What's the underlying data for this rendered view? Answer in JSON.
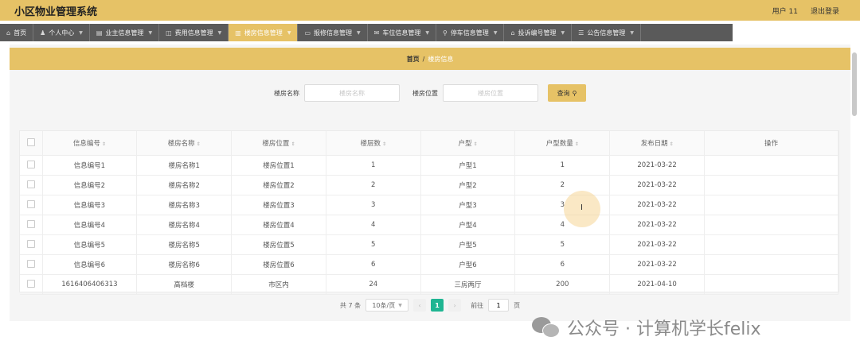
{
  "app": {
    "title": "小区物业管理系统",
    "user": "用户 11",
    "logout": "退出登录"
  },
  "nav": {
    "items": [
      {
        "icon": "⌂",
        "label": "首页",
        "active": false
      },
      {
        "icon": "♟",
        "label": "个人中心",
        "active": false
      },
      {
        "icon": "▤",
        "label": "业主信息管理",
        "active": false
      },
      {
        "icon": "◫",
        "label": "费用信息管理",
        "active": false
      },
      {
        "icon": "▥",
        "label": "楼房信息管理",
        "active": true
      },
      {
        "icon": "▭",
        "label": "报修信息管理",
        "active": false
      },
      {
        "icon": "✉",
        "label": "车位信息管理",
        "active": false
      },
      {
        "icon": "⚲",
        "label": "停车信息管理",
        "active": false
      },
      {
        "icon": "⌂",
        "label": "投诉编号管理",
        "active": false
      },
      {
        "icon": "☰",
        "label": "公告信息管理",
        "active": false
      }
    ]
  },
  "breadcrumb": {
    "home": "首页",
    "separator": "/",
    "current": "楼房信息"
  },
  "search": {
    "name_label": "楼房名称",
    "name_placeholder": "楼房名称",
    "location_label": "楼房位置",
    "location_placeholder": "楼房位置",
    "button": "查询"
  },
  "table": {
    "columns": [
      "信息编号",
      "楼房名称",
      "楼房位置",
      "楼层数",
      "户型",
      "户型数量",
      "发布日期",
      "操作"
    ],
    "rows": [
      [
        "信息编号1",
        "楼房名称1",
        "楼房位置1",
        "1",
        "户型1",
        "1",
        "2021-03-22",
        ""
      ],
      [
        "信息编号2",
        "楼房名称2",
        "楼房位置2",
        "2",
        "户型2",
        "2",
        "2021-03-22",
        ""
      ],
      [
        "信息编号3",
        "楼房名称3",
        "楼房位置3",
        "3",
        "户型3",
        "3",
        "2021-03-22",
        ""
      ],
      [
        "信息编号4",
        "楼房名称4",
        "楼房位置4",
        "4",
        "户型4",
        "4",
        "2021-03-22",
        ""
      ],
      [
        "信息编号5",
        "楼房名称5",
        "楼房位置5",
        "5",
        "户型5",
        "5",
        "2021-03-22",
        ""
      ],
      [
        "信息编号6",
        "楼房名称6",
        "楼房位置6",
        "6",
        "户型6",
        "6",
        "2021-03-22",
        ""
      ],
      [
        "1616406406313",
        "高档楼",
        "市区内",
        "24",
        "三房两厅",
        "200",
        "2021-04-10",
        ""
      ]
    ]
  },
  "pagination": {
    "total": "共 7 条",
    "page_size": "10条/页",
    "prev": "‹",
    "current": "1",
    "next": "›",
    "goto_label": "前往",
    "goto_value": "1",
    "page_unit": "页"
  },
  "watermark": {
    "text": "公众号 · 计算机学长felix"
  },
  "colors": {
    "accent": "#e6c266",
    "nav_bg": "#5a5a5a",
    "page_active": "#1fb592"
  }
}
